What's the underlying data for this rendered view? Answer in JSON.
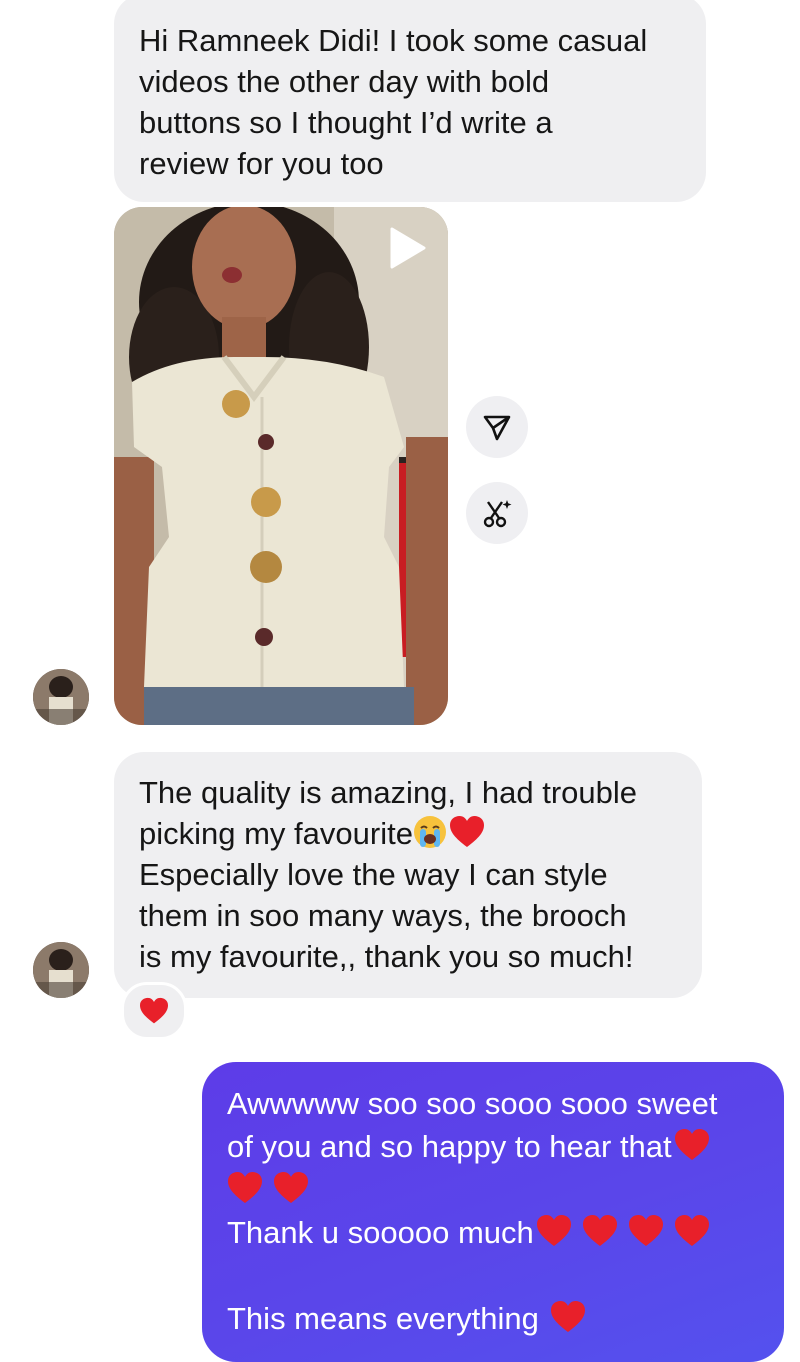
{
  "messages": {
    "msg1": {
      "lines": [
        "Hi Ramneek Didi! I took some casual",
        "videos the other day with bold",
        "buttons so I thought I’d write a",
        "review for you too"
      ]
    },
    "video": {
      "play_icon": "play-icon",
      "share_icon": "send-icon",
      "remix_icon": "scissors-sparkle-icon"
    },
    "msg2": {
      "line1": "The quality is amazing, I had trouble",
      "line2": "picking my favourite",
      "line3": "Especially love the way I can style",
      "line4": "them in soo many ways, the brooch",
      "line5": "is my favourite,, thank you so much!",
      "reaction": "heart-reaction"
    },
    "msg3": {
      "line1": "Awwwww soo soo sooo sooo sweet",
      "line2": "of you and so happy to hear that",
      "line4": "Thank u sooooo much",
      "line6": "This means everything"
    }
  },
  "colors": {
    "incoming_bubble": "#efeff1",
    "outgoing_bubble": "#5a46ea",
    "heart": "#e8202a"
  }
}
